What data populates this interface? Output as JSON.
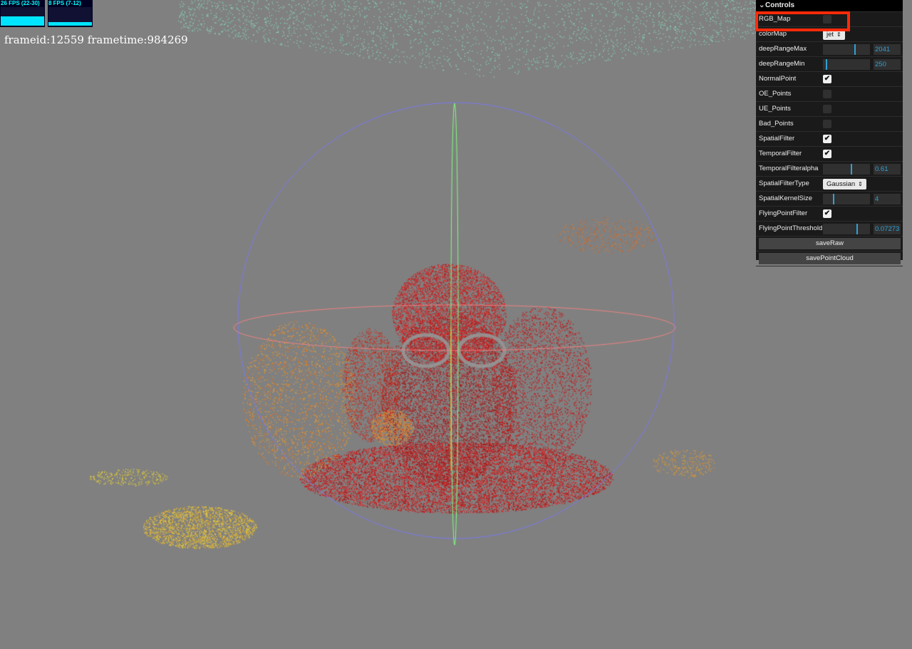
{
  "stats": {
    "fps_label": "26 FPS (22-30)",
    "ms_label": "8 FPS (7-12)",
    "fps_fill": 0.5,
    "ms_fill": 0.2
  },
  "frame_info": "frameid:12559 frametime:984269",
  "controls": {
    "title": "Controls",
    "rgb_map": {
      "label": "RGB_Map",
      "checked": false
    },
    "color_map": {
      "label": "colorMap",
      "value": "jet"
    },
    "deep_range_max": {
      "label": "deepRangeMax",
      "value": "2041",
      "fraction": 0.68
    },
    "deep_range_min": {
      "label": "deepRangeMin",
      "value": "250",
      "fraction": 0.06
    },
    "normal_point": {
      "label": "NormalPoint",
      "checked": true
    },
    "oe_points": {
      "label": "OE_Points",
      "checked": false
    },
    "ue_points": {
      "label": "UE_Points",
      "checked": false
    },
    "bad_points": {
      "label": "Bad_Points",
      "checked": false
    },
    "spatial_filter": {
      "label": "SpatialFilter",
      "checked": true
    },
    "temporal_filter": {
      "label": "TemporalFilter",
      "checked": true
    },
    "temporal_filter_alpha": {
      "label": "TemporalFilteralpha",
      "value": "0.61",
      "fraction": 0.61
    },
    "spatial_filter_type": {
      "label": "SpatialFilterType",
      "value": "Gaussian"
    },
    "spatial_kernel_size": {
      "label": "SpatialKernelSize",
      "value": "4",
      "fraction": 0.22
    },
    "flying_point_filter": {
      "label": "FlyingPointFilter",
      "checked": true
    },
    "flying_point_threshold": {
      "label": "FlyingPointThreshold",
      "value": "0.07273",
      "fraction": 0.73
    },
    "save_raw": "saveRaw",
    "save_point_cloud": "savePointCloud"
  },
  "colors": {
    "background": "#808080",
    "panel": "#1a1a1a",
    "accent": "#2fa1d6",
    "highlight": "#ff2a0a",
    "gizmo_sphere": "#7a7aee",
    "gizmo_ring": "#f08080",
    "gizmo_axis": "#7fff7f"
  }
}
